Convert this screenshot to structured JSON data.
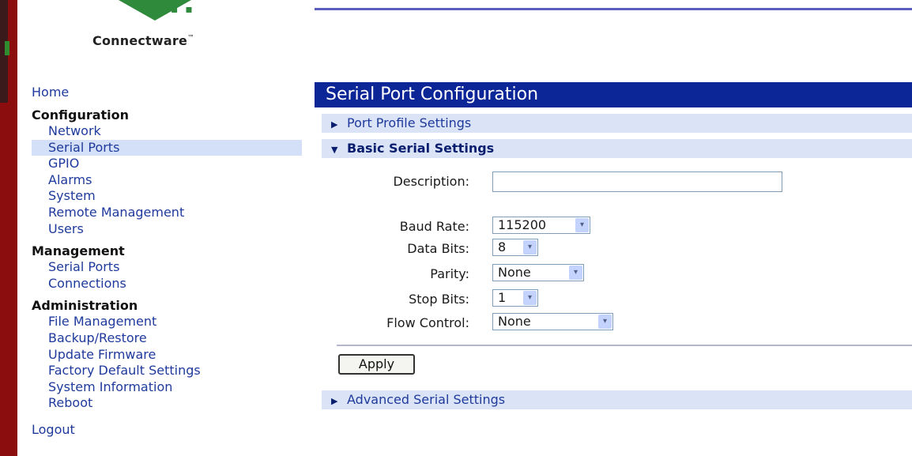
{
  "brand": {
    "name": "Connectware",
    "trademark": "™"
  },
  "nav": {
    "home": "Home",
    "sections": [
      {
        "heading": "Configuration",
        "items": [
          "Network",
          "Serial Ports",
          "GPIO",
          "Alarms",
          "System",
          "Remote Management",
          "Users"
        ],
        "active_index": 1
      },
      {
        "heading": "Management",
        "items": [
          "Serial Ports",
          "Connections"
        ]
      },
      {
        "heading": "Administration",
        "items": [
          "File Management",
          "Backup/Restore",
          "Update Firmware",
          "Factory Default Settings",
          "System Information",
          "Reboot"
        ]
      }
    ],
    "logout": "Logout"
  },
  "panel": {
    "title": "Serial Port Configuration",
    "port_profile_label": "Port Profile Settings",
    "basic_label": "Basic Serial Settings",
    "advanced_label": "Advanced Serial Settings",
    "fields": {
      "description": {
        "label": "Description:",
        "value": ""
      },
      "baud_rate": {
        "label": "Baud Rate:",
        "value": "115200"
      },
      "data_bits": {
        "label": "Data Bits:",
        "value": "8"
      },
      "parity": {
        "label": "Parity:",
        "value": "None"
      },
      "stop_bits": {
        "label": "Stop Bits:",
        "value": "1"
      },
      "flow_control": {
        "label": "Flow Control:",
        "value": "None"
      }
    },
    "apply_label": "Apply"
  },
  "colors": {
    "title_bar": "#0c2697",
    "section_bar": "#dbe4f7",
    "link": "#1f3a9c",
    "active_nav": "#d4e0f8",
    "left_edge": "#8b0d0d"
  }
}
